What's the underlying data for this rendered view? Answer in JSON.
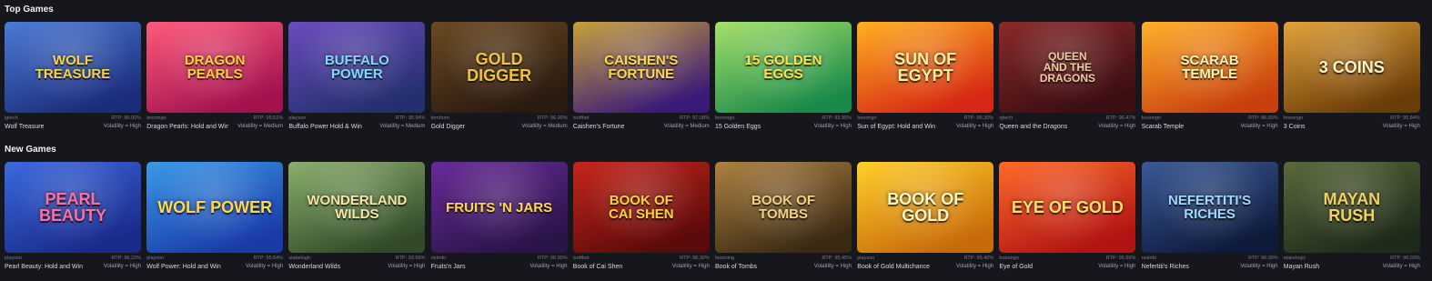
{
  "sections": [
    {
      "title": "Top Games",
      "games": [
        {
          "name": "Wolf Treasure",
          "provider": "igtech",
          "rtp": "RTP: 96.00%",
          "volatility": "Volatility = High",
          "art_text": "Wolf\nTreasure",
          "c1": "#1b2c7a",
          "c2": "#4b7bd6",
          "fg": "#f6d34a"
        },
        {
          "name": "Dragon Pearls: Hold and Win",
          "provider": "booongo",
          "rtp": "RTP: 95.51%",
          "volatility": "Volatility = Medium",
          "art_text": "Dragon\nPearls",
          "c1": "#a2124f",
          "c2": "#ff5a7a",
          "fg": "#ffcf3a"
        },
        {
          "name": "Buffalo Power Hold & Win",
          "provider": "playson",
          "rtp": "RTP: 95.94%",
          "volatility": "Volatility = Medium",
          "art_text": "Buffalo\nPower",
          "c1": "#24306e",
          "c2": "#6b4bbf",
          "fg": "#7fd8ff"
        },
        {
          "name": "Gold Digger",
          "provider": "tomhorn",
          "rtp": "RTP: 96.00%",
          "volatility": "Volatility = Medium",
          "art_text": "Gold\nDigger",
          "c1": "#2a1a10",
          "c2": "#6b4a22",
          "fg": "#f1c23e"
        },
        {
          "name": "Caishen's Fortune",
          "provider": "isoftbet",
          "rtp": "RTP: 97.08%",
          "volatility": "Volatility = Medium",
          "art_text": "Caishen's\nFortune",
          "c1": "#3a1a78",
          "c2": "#c8a03a",
          "fg": "#ffd84a"
        },
        {
          "name": "15 Golden Eggs",
          "provider": "booongo",
          "rtp": "RTP: 93.95%",
          "volatility": "Volatility = High",
          "art_text": "15 Golden\nEggs",
          "c1": "#1a8a4a",
          "c2": "#a6e06a",
          "fg": "#ffe14a"
        },
        {
          "name": "Sun of Egypt: Hold and Win",
          "provider": "booongo",
          "rtp": "RTP: 95.30%",
          "volatility": "Volatility = High",
          "art_text": "Sun of\nEgypt",
          "c1": "#d62814",
          "c2": "#ffb020",
          "fg": "#fff0a0"
        },
        {
          "name": "Queen and the Dragons",
          "provider": "igtech",
          "rtp": "RTP: 96.47%",
          "volatility": "Volatility = High",
          "art_text": "Queen\nand the\nDragons",
          "c1": "#3a0e12",
          "c2": "#8a2a2a",
          "fg": "#f2c9a0"
        },
        {
          "name": "Scarab Temple",
          "provider": "booongo",
          "rtp": "RTP: 96.00%",
          "volatility": "Volatility = High",
          "art_text": "Scarab\nTemple",
          "c1": "#c8400e",
          "c2": "#ffb02a",
          "fg": "#fff3b0"
        },
        {
          "name": "3 Coins",
          "provider": "booongo",
          "rtp": "RTP: 95.84%",
          "volatility": "Volatility = High",
          "art_text": "3 Coins",
          "c1": "#6a3c08",
          "c2": "#e2a23a",
          "fg": "#fff2c0"
        }
      ]
    },
    {
      "title": "New Games",
      "games": [
        {
          "name": "Pearl Beauty: Hold and Win",
          "provider": "playson",
          "rtp": "RTP: 96.22%",
          "volatility": "Volatility = High",
          "art_text": "Pearl\nBeauty",
          "c1": "#1a2a8a",
          "c2": "#3a6ae0",
          "fg": "#ff6fa0"
        },
        {
          "name": "Wolf Power: Hold and Win",
          "provider": "playson",
          "rtp": "RTP: 95.64%",
          "volatility": "Volatility = High",
          "art_text": "Wolf Power",
          "c1": "#1a3aa8",
          "c2": "#3a9ae8",
          "fg": "#ffd84a"
        },
        {
          "name": "Wonderland Wilds",
          "provider": "stakelogic",
          "rtp": "RTP: 93.59%",
          "volatility": "Volatility = High",
          "art_text": "Wonderland\nWilds",
          "c1": "#324a2a",
          "c2": "#8ab06a",
          "fg": "#f2e6a0"
        },
        {
          "name": "Fruits'n Jars",
          "provider": "netinfo",
          "rtp": "RTP: 96.00%",
          "volatility": "Volatility = High",
          "art_text": "Fruits 'n Jars",
          "c1": "#2a1448",
          "c2": "#6a2a9a",
          "fg": "#ffd84a"
        },
        {
          "name": "Book of Cai Shen",
          "provider": "isoftbet",
          "rtp": "RTP: 96.30%",
          "volatility": "Volatility = High",
          "art_text": "Book of\nCai Shen",
          "c1": "#5a0a0a",
          "c2": "#c8261a",
          "fg": "#ffcf3a"
        },
        {
          "name": "Book of Tombs",
          "provider": "booming",
          "rtp": "RTP: 95.45%",
          "volatility": "Volatility = High",
          "art_text": "Book of\nTombs",
          "c1": "#3a2a14",
          "c2": "#b08040",
          "fg": "#f2d080"
        },
        {
          "name": "Book of Gold Multichance",
          "provider": "playson",
          "rtp": "RTP: 95.40%",
          "volatility": "Volatility = High",
          "art_text": "Book of\nGold",
          "c1": "#c86a0a",
          "c2": "#ffd02a",
          "fg": "#fff6c8"
        },
        {
          "name": "Eye of Gold",
          "provider": "booongo",
          "rtp": "RTP: 95.69%",
          "volatility": "Volatility = High",
          "art_text": "Eye of Gold",
          "c1": "#b01414",
          "c2": "#ff6a2a",
          "fg": "#ffe06a"
        },
        {
          "name": "Nefertiti's Riches",
          "provider": "netinfo",
          "rtp": "RTP: 96.00%",
          "volatility": "Volatility = High",
          "art_text": "Nefertiti's\nRiches",
          "c1": "#0e1a3a",
          "c2": "#3a5a9a",
          "fg": "#9ad8ff"
        },
        {
          "name": "Mayan Rush",
          "provider": "stakelogic",
          "rtp": "RTP: 96.03%",
          "volatility": "Volatility = High",
          "art_text": "Mayan\nRush",
          "c1": "#1e2a1a",
          "c2": "#5a6a3a",
          "fg": "#f2d060"
        }
      ]
    }
  ]
}
